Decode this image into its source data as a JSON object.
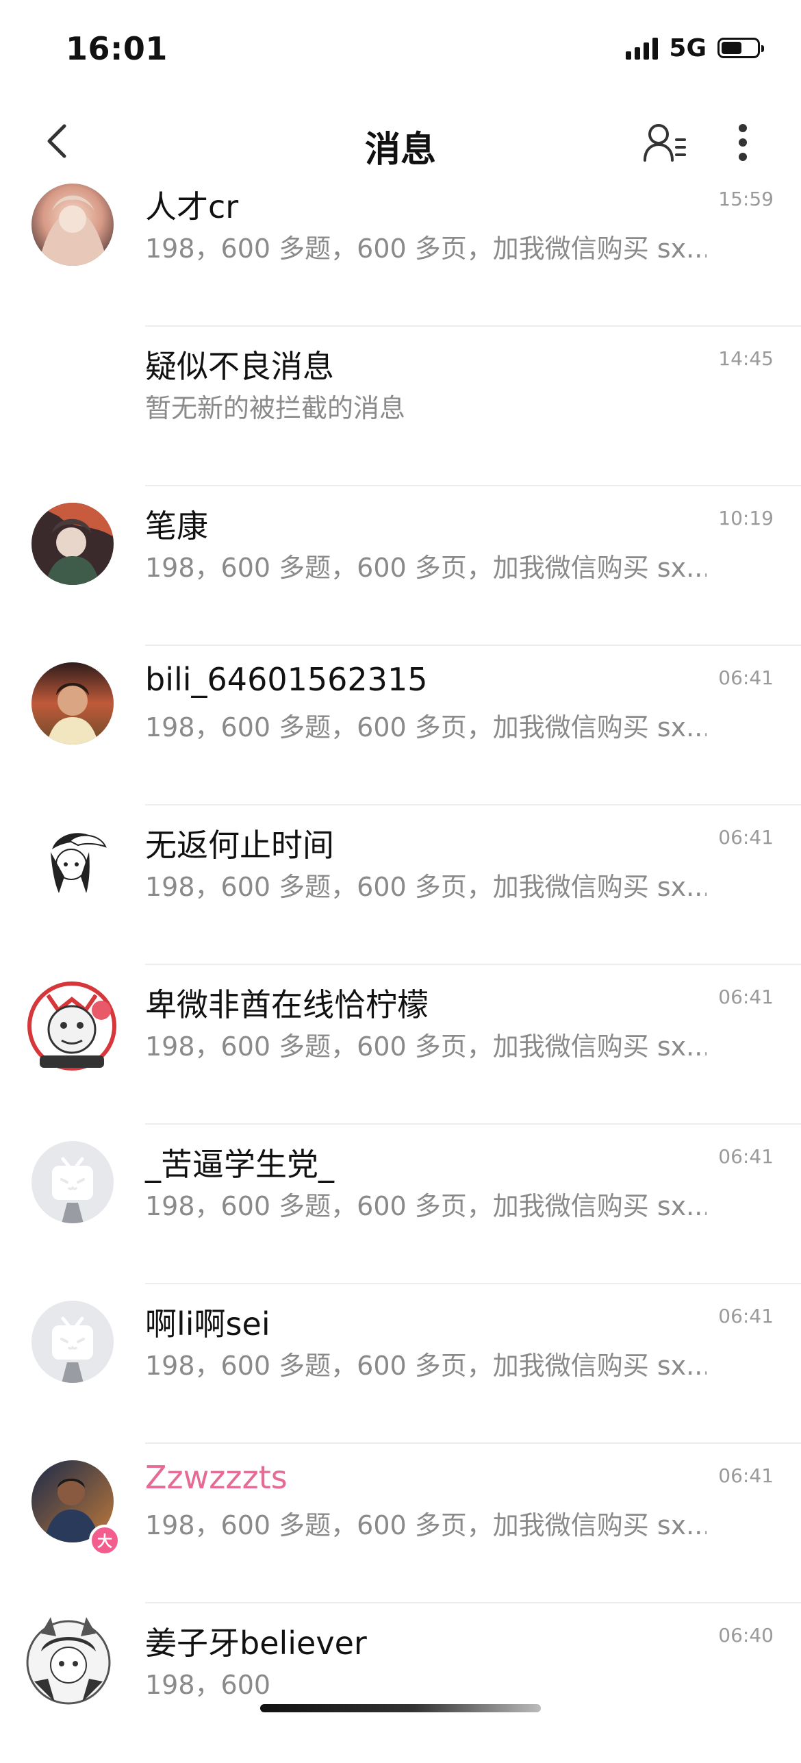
{
  "status_bar": {
    "time": "16:01",
    "network": "5G",
    "icons": [
      "signal-icon",
      "battery-icon"
    ]
  },
  "nav": {
    "title": "消息",
    "icons": [
      "back-chevron-icon",
      "contacts-icon",
      "more-vertical-icon"
    ]
  },
  "colors": {
    "vip_name": "#e56a94",
    "vip_badge": "#f25d8e",
    "preview_text": "#8a8a8a",
    "timestamp": "#9a9a9a",
    "divider": "#ededed"
  },
  "messages": [
    {
      "name": "人才cr",
      "preview": "198，600 多题，600 多页，加我微信购买 sx...",
      "time": "15:59",
      "avatar": "anime-girl-avatar"
    },
    {
      "name": "疑似不良消息",
      "preview": "暂无新的被拦截的消息",
      "time": "14:45",
      "avatar": "none"
    },
    {
      "name": "笔康",
      "preview": "198，600 多题，600 多页，加我微信购买 sx...",
      "time": "10:19",
      "avatar": "anime-character-avatar"
    },
    {
      "name": "bili_64601562315",
      "preview": "198，600 多题，600 多页，加我微信购买 sx...",
      "time": "06:41",
      "avatar": "boy-portrait-avatar"
    },
    {
      "name": "无返何止时间",
      "preview": "198，600 多题，600 多页，加我微信购买 sx...",
      "time": "06:41",
      "avatar": "manga-girl-avatar"
    },
    {
      "name": "卑微非酋在线恰柠檬",
      "preview": "198，600 多题，600 多页，加我微信购买 sx...",
      "time": "06:41",
      "avatar": "meme-face-avatar"
    },
    {
      "name": "_苦逼学生党_",
      "preview": "198，600 多题，600 多页，加我微信购买 sx...",
      "time": "06:41",
      "avatar": "default-tv-avatar"
    },
    {
      "name": "啊li啊sei",
      "preview": "198，600 多题，600 多页，加我微信购买 sx...",
      "time": "06:41",
      "avatar": "default-tv-avatar"
    },
    {
      "name": "Zzwzzzts",
      "preview": "198，600 多题，600 多页，加我微信购买 sx...",
      "time": "06:41",
      "avatar": "player-photo-avatar",
      "badge": "大"
    },
    {
      "name": "姜子牙believer",
      "preview": "198，600",
      "time": "06:40",
      "avatar": "manga-character-avatar"
    }
  ]
}
